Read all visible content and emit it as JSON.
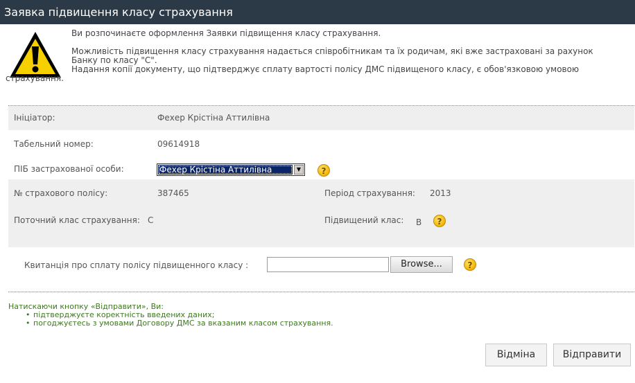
{
  "header": {
    "title": "Заявка підвищення класу страхування"
  },
  "intro": {
    "line1": "Ви розпочинаєте оформлення Заявки підвищення класу страхування.",
    "line2a": "Можливість підвищення класу страхування надається співробітникам та їх родичам, які вже застраховані за рахунок",
    "line2b": "Банку по класу \"С\".",
    "line3a": "Надання копії документу, що підтверджує сплату вартості полісу ДМС підвищеного класу, є обов'язковою умовою",
    "line3b": "страхування."
  },
  "form": {
    "initiator_label": "Ініціатор:",
    "initiator_value": "Фехер Крістіна Аттилівна",
    "tabnum_label": "Табельний номер:",
    "tabnum_value": "09614918",
    "insured_label": "ПІБ застрахованої особи:",
    "insured_selected": "Фехер Крістіна Аттилівна",
    "policy_label": "№ страхового полісу:",
    "policy_value": "387465",
    "period_label": "Період страхування:",
    "period_value": "2013",
    "current_class_label": "Поточний клас страхування:",
    "current_class_value": "С",
    "upgraded_class_label": "Підвищений клас:",
    "upgraded_class_value": "B",
    "receipt_label": "Квитанція про сплату полісу підвищенного класу :",
    "browse_label": "Browse..."
  },
  "notice": {
    "lead": "Натискаючи кнопку «Відправити», Ви:",
    "items": [
      "підтверджуєте коректність введених даних;",
      "погоджуєтесь з умовами Договору ДМС за вказаним класом страхування."
    ]
  },
  "actions": {
    "cancel_label": "Відміна",
    "submit_label": "Відправити"
  },
  "icons": {
    "warning": "warning-triangle-icon",
    "help": "help-question-icon"
  },
  "colors": {
    "titlebar": "#2c3a47",
    "notice_text": "#3b7a1b",
    "band": "#efefef"
  }
}
